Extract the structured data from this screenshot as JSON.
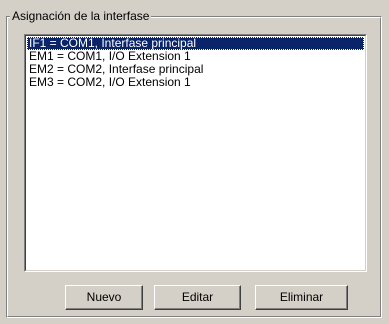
{
  "group": {
    "title": "Asignación de la interfase"
  },
  "list": {
    "items": [
      {
        "label": "IF1 = COM1, Interfase principal",
        "selected": true
      },
      {
        "label": "EM1 = COM1, I/O Extension 1",
        "selected": false
      },
      {
        "label": "EM2 = COM2, Interfase principal",
        "selected": false
      },
      {
        "label": "EM3 = COM2, I/O Extension 1",
        "selected": false
      }
    ]
  },
  "buttons": {
    "new_label": "Nuevo",
    "edit_label": "Editar",
    "delete_label": "Eliminar"
  },
  "colors": {
    "face": "#d4d0c8",
    "selection": "#0a246a",
    "selection_text": "#ffffff"
  }
}
